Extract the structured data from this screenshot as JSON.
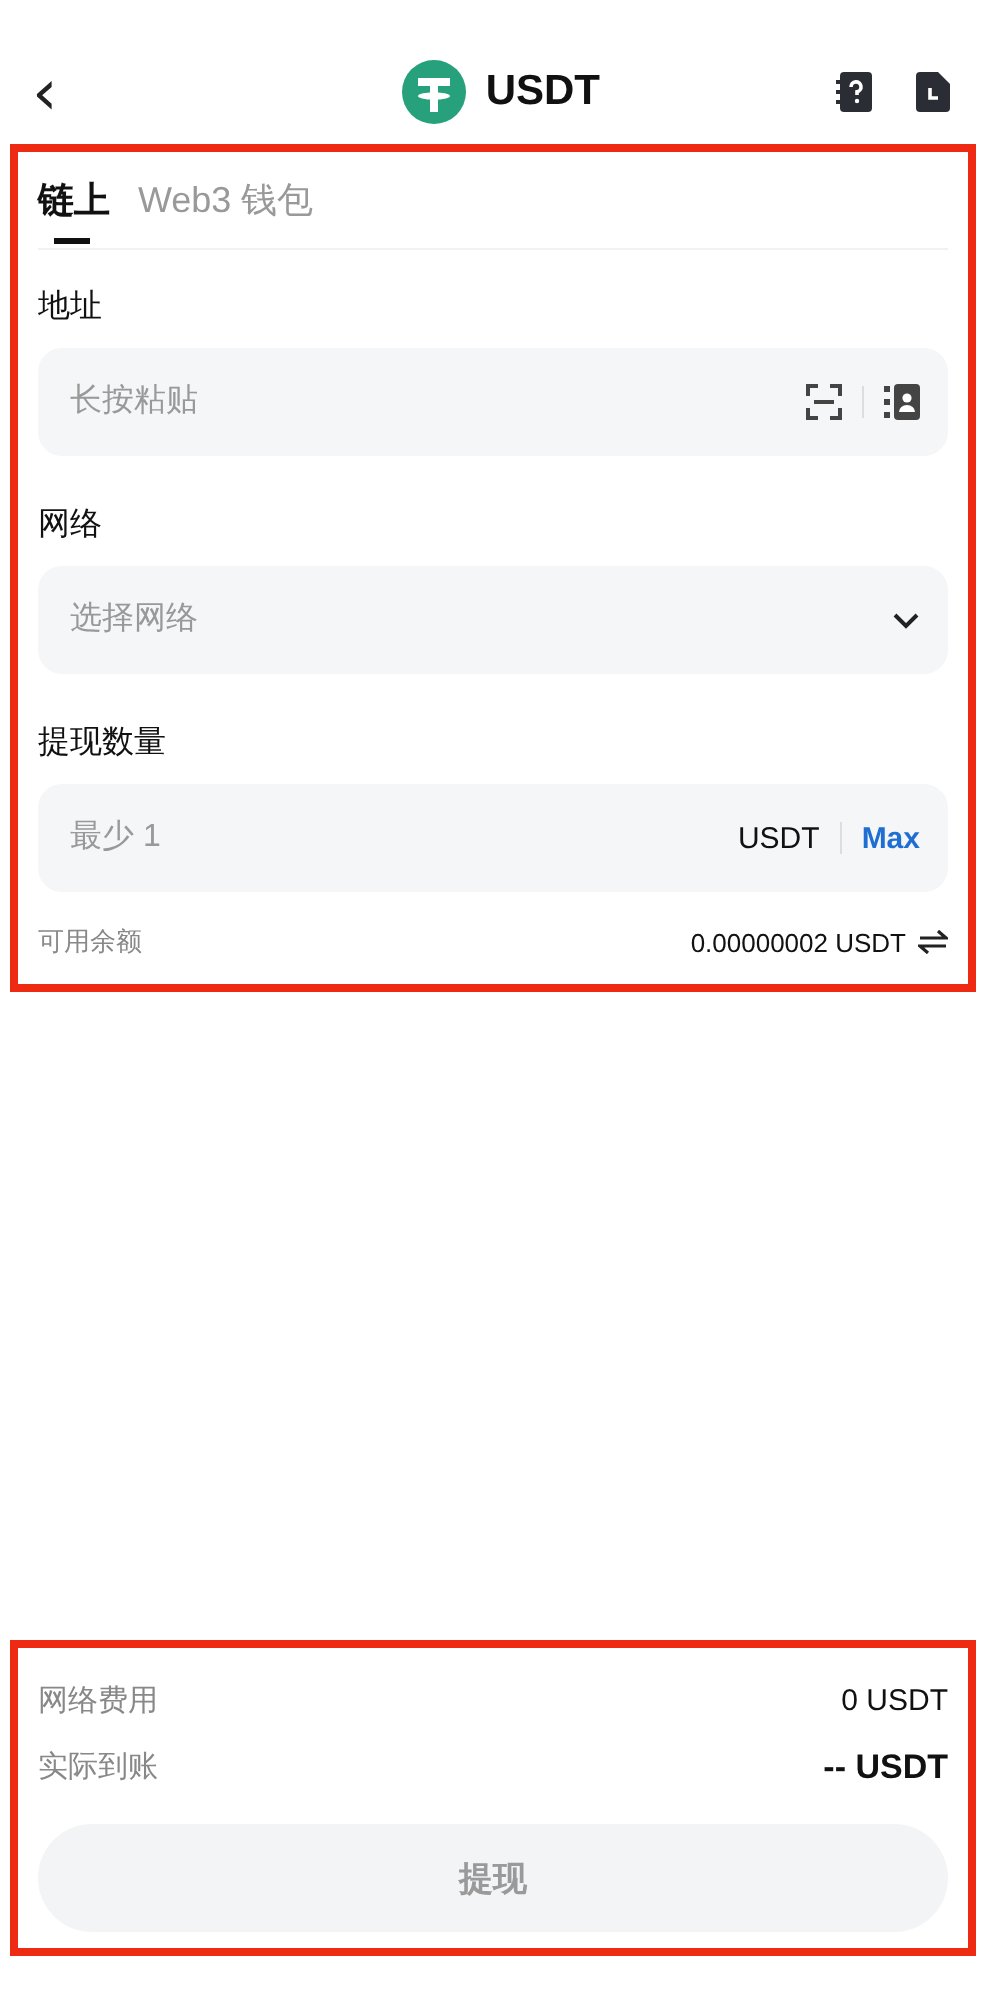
{
  "header": {
    "back": "‹",
    "title": "USDT"
  },
  "tabs": [
    {
      "label": "链上",
      "selected": true
    },
    {
      "label": "Web3 钱包",
      "selected": false
    }
  ],
  "fields": [
    {
      "kind": "address",
      "label": "地址",
      "placeholder": "长按粘贴"
    },
    {
      "kind": "select",
      "label": "网络",
      "placeholder": "选择网络"
    },
    {
      "kind": "amount",
      "label": "提现数量",
      "placeholder": "最少 1",
      "unit": "USDT",
      "max": "Max"
    }
  ],
  "balance": {
    "label": "可用余额",
    "value": "0.00000002 USDT"
  },
  "summary": [
    {
      "label": "网络费用",
      "value": "0 USDT"
    },
    {
      "label": "实际到账",
      "value": "-- USDT"
    }
  ],
  "submit": {
    "label": "提现",
    "disabled": true
  }
}
